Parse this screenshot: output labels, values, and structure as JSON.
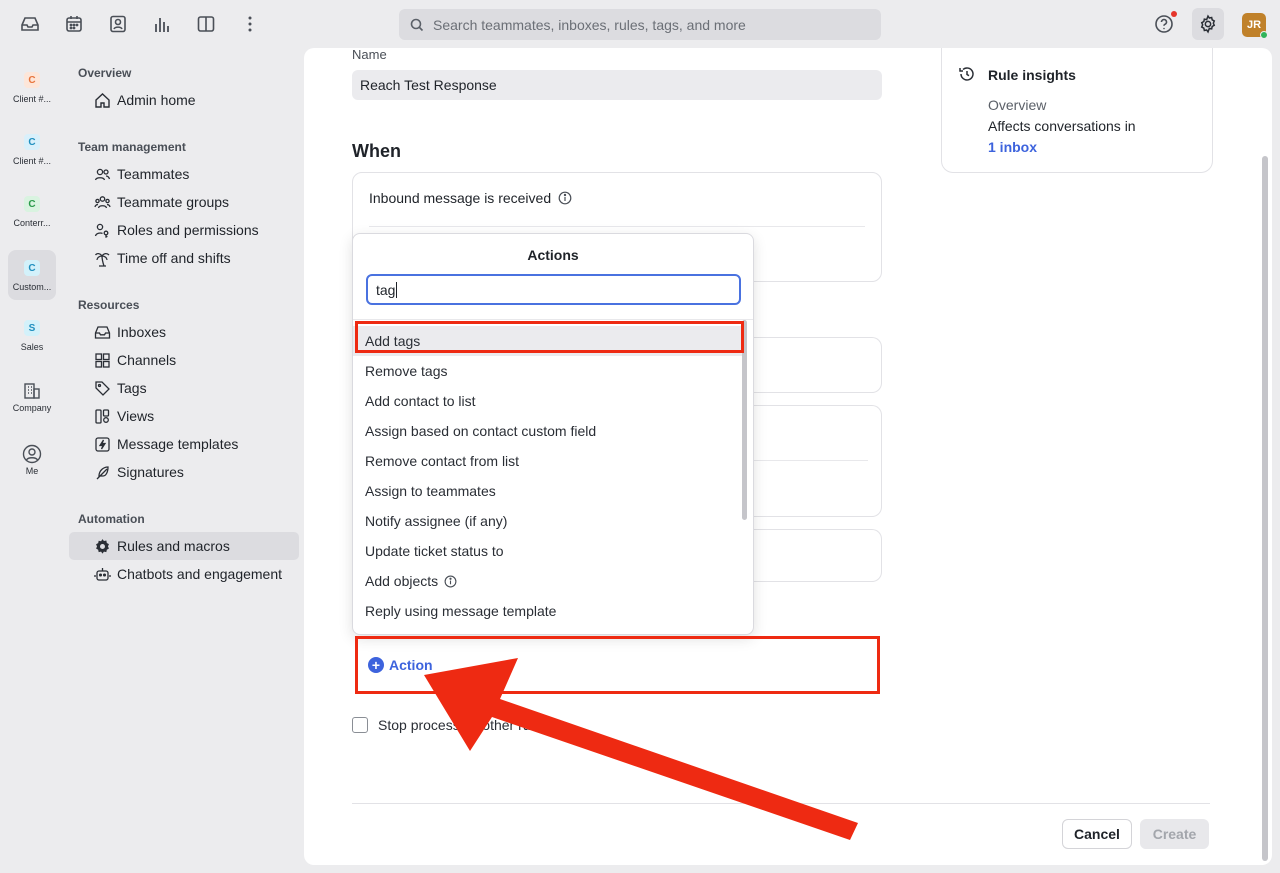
{
  "topbar": {
    "search_placeholder": "Search teammates, inboxes, rules, tags, and more",
    "avatar_initials": "JR"
  },
  "rail": [
    {
      "badge": "C",
      "label": "Client #...",
      "color": "#e8743b",
      "bg": "#fde6d9"
    },
    {
      "badge": "C",
      "label": "Client #...",
      "color": "#1f8fbf",
      "bg": "#d9f0fb"
    },
    {
      "badge": "C",
      "label": "Conterr...",
      "color": "#2a9a4a",
      "bg": "#d9f3e0"
    },
    {
      "badge": "C",
      "label": "Custom...",
      "color": "#1f8fbf",
      "bg": "#d3f1fa"
    },
    {
      "badge": "S",
      "label": "Sales",
      "color": "#1f8fbf",
      "bg": "#d3f1fa"
    },
    {
      "label": "Company"
    },
    {
      "label": "Me"
    }
  ],
  "nav": {
    "overview_heading": "Overview",
    "admin_home": "Admin home",
    "team_heading": "Team management",
    "teammates": "Teammates",
    "teammate_groups": "Teammate groups",
    "roles": "Roles and permissions",
    "time_off": "Time off and shifts",
    "resources_heading": "Resources",
    "inboxes": "Inboxes",
    "channels": "Channels",
    "tags": "Tags",
    "views": "Views",
    "templates": "Message templates",
    "signatures": "Signatures",
    "automation_heading": "Automation",
    "rules": "Rules and macros",
    "chatbots": "Chatbots and engagement"
  },
  "form": {
    "name_label": "Name",
    "name_value": "Reach Test Response",
    "when_title": "When",
    "trigger": "Inbound message is received",
    "action_label": "Action",
    "stop_processing": "Stop processing other rules",
    "cancel": "Cancel",
    "create": "Create"
  },
  "dropdown": {
    "title": "Actions",
    "search_value": "tag",
    "items": [
      "Add tags",
      "Remove tags",
      "Add contact to list",
      "Assign based on contact custom field",
      "Remove contact from list",
      "Assign to teammates",
      "Notify assignee (if any)",
      "Update ticket status to",
      "Add objects",
      "Reply using message template"
    ]
  },
  "insights": {
    "title": "Rule insights",
    "overview": "Overview",
    "affects": "Affects conversations in",
    "link": "1 inbox"
  },
  "colors": {
    "accent": "#3d63dd",
    "annotation_red": "#ee2a12"
  }
}
